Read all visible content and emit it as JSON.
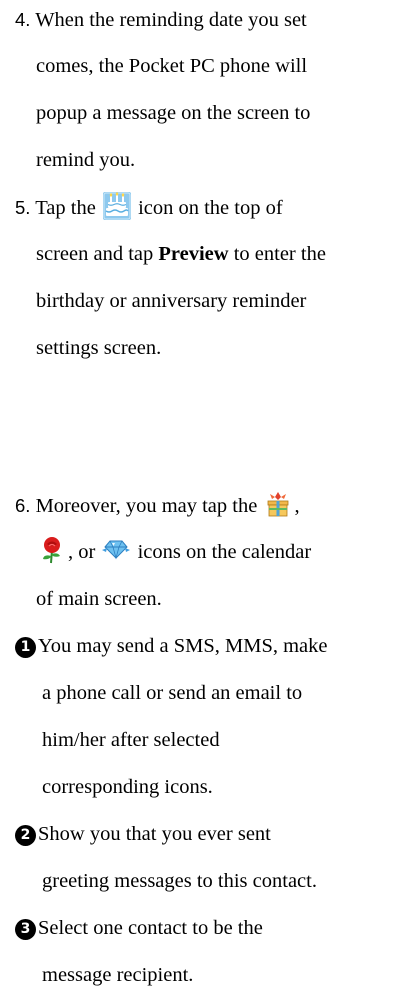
{
  "step4": {
    "number": "4.",
    "lines": [
      "When the reminding date you set",
      "comes, the Pocket PC phone will",
      "popup a message on the screen to",
      "remind you."
    ]
  },
  "step5": {
    "number": "5.",
    "line1_before": "Tap the",
    "line1_icon": "birthday-cake-icon",
    "line1_after": "icon on the top of",
    "line2_before": "screen and tap",
    "line2_bold": "Preview",
    "line2_after": "to enter the",
    "line3": "birthday or anniversary reminder",
    "line4": "settings screen."
  },
  "step6": {
    "number": "6.",
    "line1_before": "Moreover, you may tap the",
    "line1_icon": "gift-box-icon",
    "line1_after": ",",
    "line2_icon1": "rose-icon",
    "line2_mid": ", or",
    "line2_icon2": "diamond-icon",
    "line2_after": "icons on the calendar",
    "line3": "of main screen."
  },
  "notes": [
    {
      "marker": "1",
      "lines": [
        "You may send a SMS, MMS, make",
        "a phone call or send an email to",
        "him/her after selected",
        "corresponding icons."
      ]
    },
    {
      "marker": "2",
      "lines": [
        "Show you that you ever sent",
        "greeting messages to this contact."
      ]
    },
    {
      "marker": "3",
      "lines": [
        "Select one contact to be the",
        "message recipient."
      ]
    }
  ]
}
